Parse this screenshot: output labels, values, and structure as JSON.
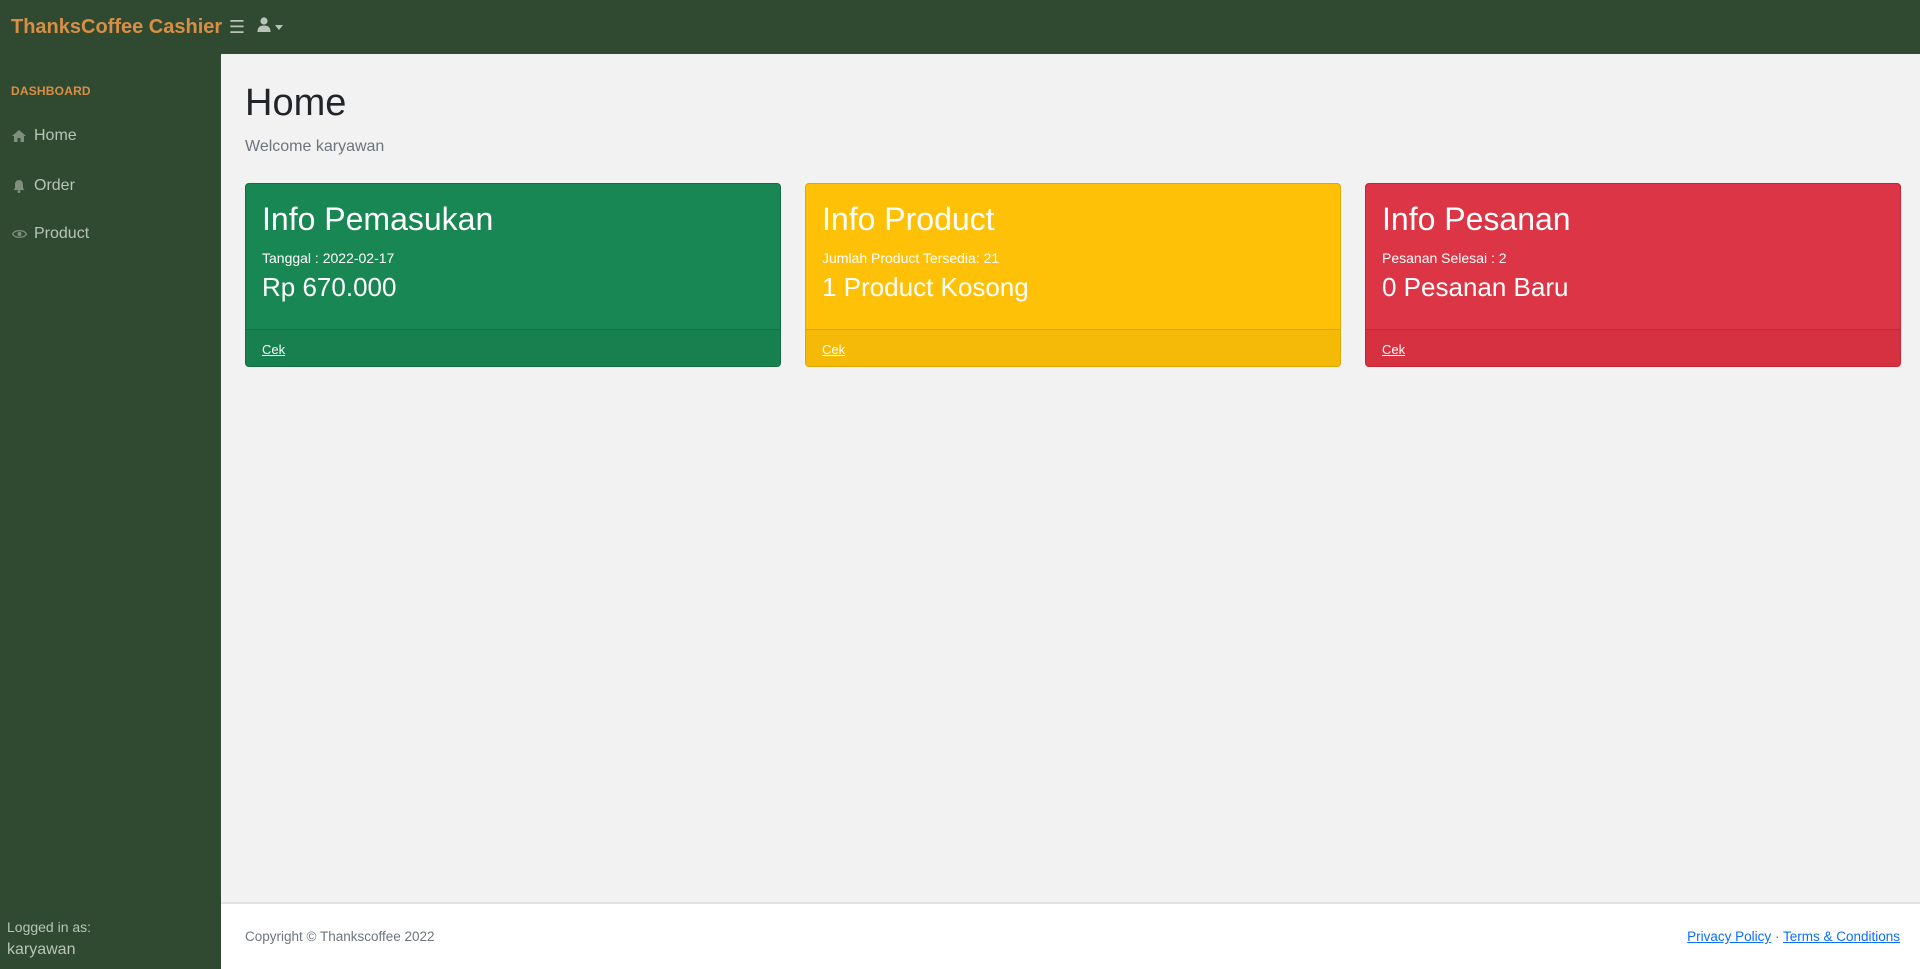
{
  "app": {
    "brand": "ThanksCoffee Cashier",
    "toggle_icon": "☰"
  },
  "sidebar": {
    "heading": "DASHBOARD",
    "items": [
      {
        "label": "Home",
        "icon": "home-icon"
      },
      {
        "label": "Order",
        "icon": "bell-icon"
      },
      {
        "label": "Product",
        "icon": "eye-icon"
      }
    ],
    "footer_label": "Logged in as:",
    "footer_user": "karyawan"
  },
  "main": {
    "title": "Home",
    "welcome": "Welcome karyawan",
    "cards": [
      {
        "title": "Info Pemasukan",
        "sub": "Tanggal : 2022-02-17",
        "big": "Rp 670.000",
        "link": "Cek",
        "color": "#198754"
      },
      {
        "title": "Info Product",
        "sub": "Jumlah Product Tersedia: 21",
        "big": "1 Product Kosong",
        "link": "Cek",
        "color": "#ffc107"
      },
      {
        "title": "Info Pesanan",
        "sub": "Pesanan Selesai : 2",
        "big": "0 Pesanan Baru",
        "link": "Cek",
        "color": "#dc3545"
      }
    ]
  },
  "footer": {
    "copyright": "Copyright © Thankscoffee 2022",
    "privacy": "Privacy Policy",
    "separator": "·",
    "terms": "Terms & Conditions"
  },
  "colors": {
    "nav_bg": "#304a32",
    "brand": "#d88f45",
    "nav_text": "#b9c3b7"
  }
}
